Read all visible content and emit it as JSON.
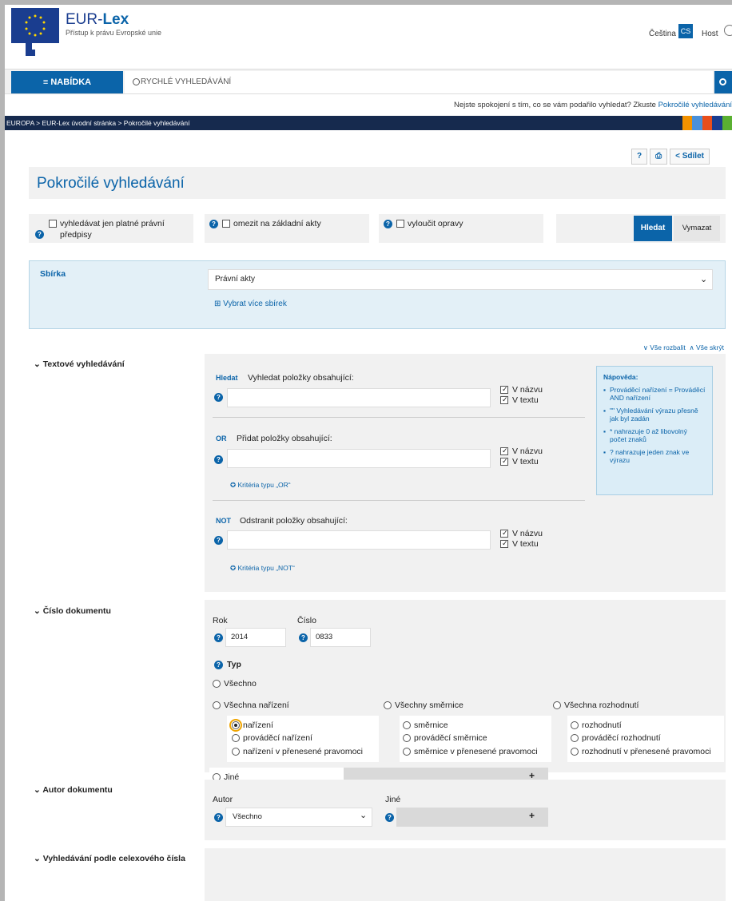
{
  "header": {
    "logo_title_a": "EUR-",
    "logo_title_b": "Lex",
    "logo_sub": "Přístup k právu Evropské unie",
    "language": "Čeština",
    "language_code": "CS",
    "user": "Host"
  },
  "search": {
    "menu_label": "≡  NABÍDKA",
    "placeholder": "RYCHLÉ VYHLEDÁVÁNÍ",
    "unhappy_text": "Nejste spokojení s tím, co se vám podařilo vyhledat? Zkuste ",
    "unhappy_link": "Pokročilé vyhledávání"
  },
  "breadcrumb": "EUROPA  >  EUR-Lex úvodní stránka  >  Pokročilé vyhledávání",
  "breadcrumb_colors": [
    "#f39200",
    "#4a90d9",
    "#e94e1b",
    "#1a3d8f",
    "#5ab031"
  ],
  "tools": {
    "help": "?",
    "print": "⎙",
    "share": "< Sdílet"
  },
  "title": "Pokročilé vyhledávání",
  "options": {
    "valid_only_1": "vyhledávat jen platné právní",
    "valid_only_2": "předpisy",
    "base_acts": "omezit na základní akty",
    "exclude_corr": "vyloučit opravy",
    "search_btn": "Hledat",
    "clear_btn": "Vymazat"
  },
  "collection": {
    "label": "Sbírka",
    "selected": "Právní akty",
    "more": "⊞  Vybrat více sbírek"
  },
  "expand": {
    "expand_all": "∨ Vše rozbalit",
    "collapse_all": "∧ Vše skrýt"
  },
  "text_search": {
    "label": "Textové vyhledávání",
    "find_tag": "Hledat",
    "find_label": "Vyhledat položky obsahující:",
    "or_tag": "OR",
    "or_label": "Přidat položky obsahující:",
    "or_link": "✪ Kritéria typu „OR“",
    "not_tag": "NOT",
    "not_label": "Odstranit položky obsahující:",
    "not_link": "✪ Kritéria typu „NOT“",
    "in_title": "V názvu",
    "in_text": "V textu"
  },
  "help_box": {
    "title": "Nápověda:",
    "items": [
      "Prováděcí nařízení = Prováděcí AND nařízení",
      "\"\" Vyhledávání výrazu přesně jak byl zadán",
      "* nahrazuje 0 až libovolný počet znaků",
      "? nahrazuje jeden znak ve výrazu"
    ]
  },
  "doc_number": {
    "label": "Číslo dokumentu",
    "year_label": "Rok",
    "year_value": "2014",
    "number_label": "Číslo",
    "number_value": "0833",
    "type_label": "Typ",
    "all": "Všechno",
    "all_reg": "Všechna nařízení",
    "all_dir": "Všechny směrnice",
    "all_dec": "Všechna rozhodnutí",
    "reg": "nařízení",
    "impl_reg": "prováděcí nařízení",
    "del_reg": "nařízení v přenesené pravomoci",
    "dir": "směrnice",
    "impl_dir": "prováděcí směrnice",
    "del_dir": "směrnice v přenesené pravomoci",
    "dec": "rozhodnutí",
    "impl_dec": "prováděcí rozhodnutí",
    "del_dec": "rozhodnutí v přenesené pravomoci",
    "other": "Jiné"
  },
  "author": {
    "label": "Autor dokumentu",
    "author_label": "Autor",
    "author_value": "Všechno",
    "other_label": "Jiné"
  },
  "celex": {
    "label": "Vyhledávání podle celexového čísla"
  }
}
